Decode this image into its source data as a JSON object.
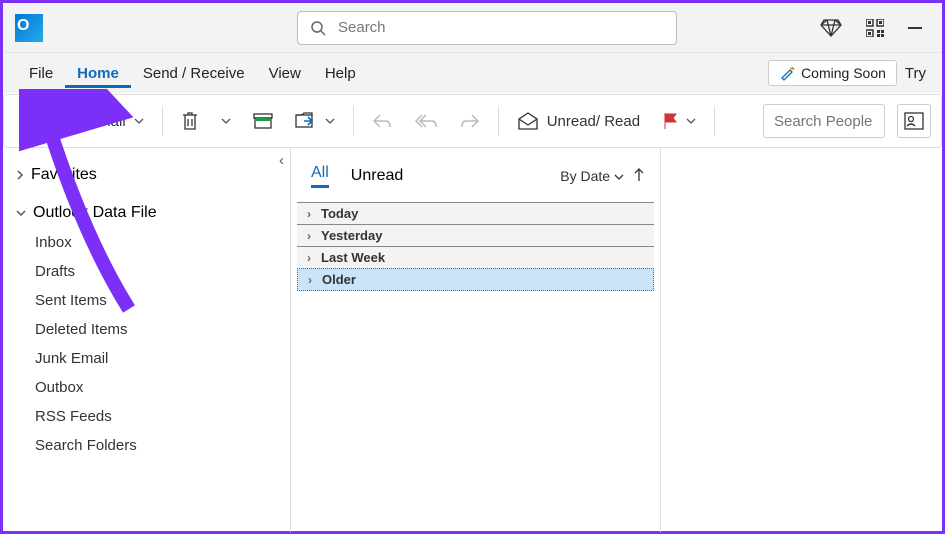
{
  "titlebar": {
    "search_placeholder": "Search"
  },
  "menu": {
    "file": "File",
    "home": "Home",
    "send_receive": "Send / Receive",
    "view": "View",
    "help": "Help",
    "coming_soon": "Coming Soon",
    "try": "Try"
  },
  "toolbar": {
    "new_email": "New Email",
    "unread_read": "Unread/ Read",
    "search_people_placeholder": "Search People"
  },
  "nav": {
    "favorites": "Favorites",
    "data_file": "Outlook Data File",
    "folders": [
      "Inbox",
      "Drafts",
      "Sent Items",
      "Deleted Items",
      "Junk Email",
      "Outbox",
      "RSS Feeds",
      "Search Folders"
    ]
  },
  "list": {
    "tab_all": "All",
    "tab_unread": "Unread",
    "sort_label": "By Date",
    "groups": [
      "Today",
      "Yesterday",
      "Last Week",
      "Older"
    ],
    "selected_group_index": 3
  }
}
